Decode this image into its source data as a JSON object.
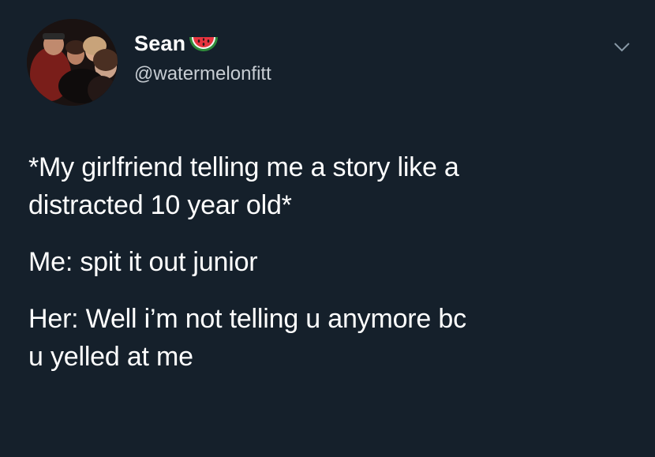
{
  "author": {
    "display_name": "Sean",
    "handle": "@watermelonfitt",
    "name_emoji_icon": "watermelon-icon",
    "avatar": "group-photo-avatar"
  },
  "menu": {
    "icon": "chevron-down-icon"
  },
  "tweet": {
    "line_1": "*My girlfriend telling me a story like a",
    "line_2": "distracted 10 year old*",
    "line_3": "Me: spit it out junior",
    "line_4": "Her: Well i’m not telling u anymore bc",
    "line_5": "u yelled at me"
  },
  "colors": {
    "background": "#15202b",
    "text": "#ffffff",
    "secondary_text": "#c7cdd3",
    "chevron": "#8899a6"
  }
}
